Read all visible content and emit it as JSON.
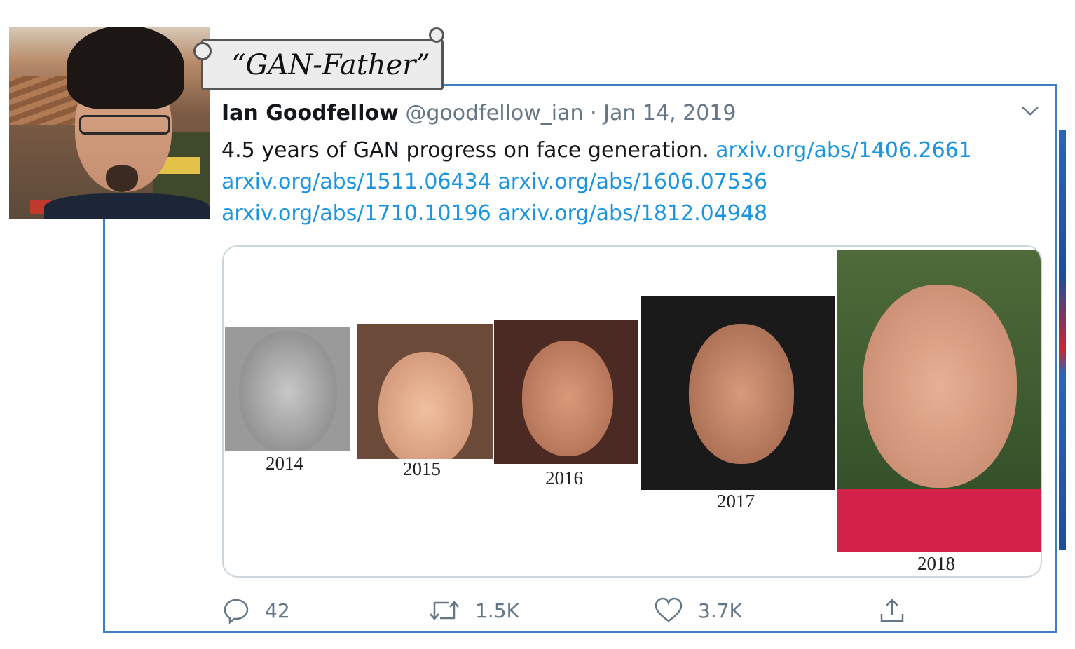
{
  "banner": {
    "text": "“GAN-Father”"
  },
  "tweet": {
    "author_name": "Ian Goodfellow",
    "handle": "@goodfellow_ian",
    "separator": "·",
    "date": "Jan 14, 2019",
    "text": "4.5 years of GAN progress on face generation.",
    "links": [
      "arxiv.org/abs/1406.2661",
      "arxiv.org/abs/1511.06434",
      "arxiv.org/abs/1606.07536",
      "arxiv.org/abs/1710.10196",
      "arxiv.org/abs/1812.04948"
    ],
    "media_years": [
      "2014",
      "2015",
      "2016",
      "2017",
      "2018"
    ],
    "actions": {
      "replies": "42",
      "retweets": "1.5K",
      "likes": "3.7K"
    }
  },
  "icons": {
    "menu": "chevron-down-icon",
    "reply": "reply-icon",
    "retweet": "retweet-icon",
    "like": "heart-icon",
    "share": "share-icon"
  },
  "colors": {
    "card_border": "#3f7fc1",
    "link": "#1b95e0",
    "text_primary": "#14171a",
    "text_secondary": "#657786"
  }
}
